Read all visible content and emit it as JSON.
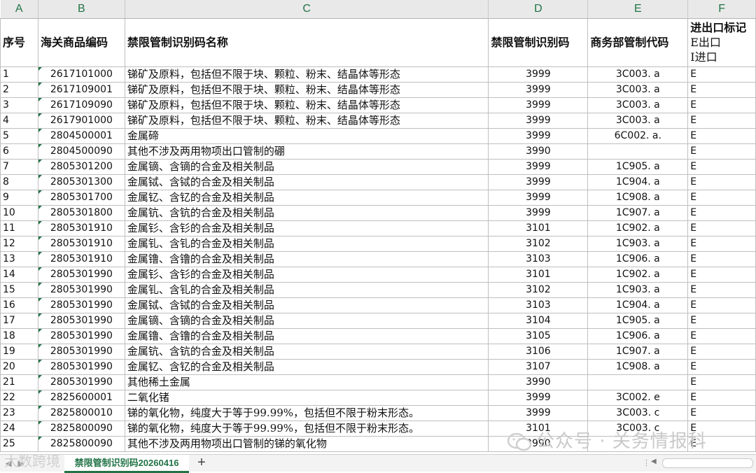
{
  "column_letters": [
    "A",
    "B",
    "C",
    "D",
    "E",
    "F"
  ],
  "header": {
    "seq": "序号",
    "hs_code": "海关商品编码",
    "name": "禁限管制识别码名称",
    "control_code": "禁限管制识别码",
    "mofcom_code": "商务部管制代码",
    "flag_title": "进出口标记",
    "flag_export": "E出口",
    "flag_import": "I进口"
  },
  "rows": [
    {
      "seq": "1",
      "hs": "2617101000",
      "name": "锑矿及原料，包括但不限于块、颗粒、粉末、结晶体等形态",
      "code": "3999",
      "mofcom": "3C003. a",
      "flag": "E"
    },
    {
      "seq": "2",
      "hs": "2617109001",
      "name": "锑矿及原料，包括但不限于块、颗粒、粉末、结晶体等形态",
      "code": "3999",
      "mofcom": "3C003. a",
      "flag": "E"
    },
    {
      "seq": "3",
      "hs": "2617109090",
      "name": "锑矿及原料，包括但不限于块、颗粒、粉末、结晶体等形态",
      "code": "3999",
      "mofcom": "3C003. a",
      "flag": "E"
    },
    {
      "seq": "4",
      "hs": "2617901000",
      "name": "锑矿及原料，包括但不限于块、颗粒、粉末、结晶体等形态",
      "code": "3999",
      "mofcom": "3C003. a",
      "flag": "E"
    },
    {
      "seq": "5",
      "hs": "2804500001",
      "name": "金属碲",
      "code": "3999",
      "mofcom": "6C002. a.",
      "flag": "E"
    },
    {
      "seq": "6",
      "hs": "2804500090",
      "name": "其他不涉及两用物项出口管制的硼",
      "code": "3990",
      "mofcom": "",
      "flag": "E"
    },
    {
      "seq": "7",
      "hs": "2805301200",
      "name": "金属镝、含镝的合金及相关制品",
      "code": "3999",
      "mofcom": "1C905. a",
      "flag": "E"
    },
    {
      "seq": "8",
      "hs": "2805301300",
      "name": "金属铽、含铽的合金及相关制品",
      "code": "3999",
      "mofcom": "1C904. a",
      "flag": "E"
    },
    {
      "seq": "9",
      "hs": "2805301700",
      "name": "金属钇、含钇的合金及相关制品",
      "code": "3999",
      "mofcom": "1C908. a",
      "flag": "E"
    },
    {
      "seq": "10",
      "hs": "2805301800",
      "name": "金属钪、含钪的合金及相关制品",
      "code": "3999",
      "mofcom": "1C907. a",
      "flag": "E"
    },
    {
      "seq": "11",
      "hs": "2805301910",
      "name": "金属钐、含钐的合金及相关制品",
      "code": "3101",
      "mofcom": "1C902. a",
      "flag": "E"
    },
    {
      "seq": "12",
      "hs": "2805301910",
      "name": "金属钆、含钆的合金及相关制品",
      "code": "3102",
      "mofcom": "1C903. a",
      "flag": "E"
    },
    {
      "seq": "13",
      "hs": "2805301910",
      "name": "金属镥、含镥的合金及相关制品",
      "code": "3103",
      "mofcom": "1C906. a",
      "flag": "E"
    },
    {
      "seq": "14",
      "hs": "2805301990",
      "name": "金属钐、含钐的合金及相关制品",
      "code": "3101",
      "mofcom": "1C902. a",
      "flag": "E"
    },
    {
      "seq": "15",
      "hs": "2805301990",
      "name": "金属钆、含钆的合金及相关制品",
      "code": "3102",
      "mofcom": "1C903. a",
      "flag": "E"
    },
    {
      "seq": "16",
      "hs": "2805301990",
      "name": "金属铽、含铽的合金及相关制品",
      "code": "3103",
      "mofcom": "1C904. a",
      "flag": "E"
    },
    {
      "seq": "17",
      "hs": "2805301990",
      "name": "金属镝、含镝的合金及相关制品",
      "code": "3104",
      "mofcom": "1C905. a",
      "flag": "E"
    },
    {
      "seq": "18",
      "hs": "2805301990",
      "name": "金属镥、含镥的合金及相关制品",
      "code": "3105",
      "mofcom": "1C906. a",
      "flag": "E"
    },
    {
      "seq": "19",
      "hs": "2805301990",
      "name": "金属钪、含钪的合金及相关制品",
      "code": "3106",
      "mofcom": "1C907. a",
      "flag": "E"
    },
    {
      "seq": "20",
      "hs": "2805301990",
      "name": "金属钇、含钇的合金及相关制品",
      "code": "3107",
      "mofcom": "1C908. a",
      "flag": "E"
    },
    {
      "seq": "21",
      "hs": "2805301990",
      "name": "其他稀土金属",
      "code": "3990",
      "mofcom": "",
      "flag": "E"
    },
    {
      "seq": "22",
      "hs": "2825600001",
      "name": "二氧化锗",
      "code": "3999",
      "mofcom": "3C002. e",
      "flag": "E"
    },
    {
      "seq": "23",
      "hs": "2825800010",
      "name": "锑的氧化物，纯度大于等于99.99%，包括但不限于粉末形态。",
      "code": "3999",
      "mofcom": "3C003. c",
      "flag": "E"
    },
    {
      "seq": "24",
      "hs": "2825800090",
      "name": "锑的氧化物，纯度大于等于99.99%，包括但不限于粉末形态。",
      "code": "3101",
      "mofcom": "3C003. c",
      "flag": "E"
    },
    {
      "seq": "25",
      "hs": "2825800090",
      "name": "其他不涉及两用物项出口管制的锑的氧化物",
      "code": "3990",
      "mofcom": "",
      "flag": "E"
    }
  ],
  "sheet_tab": "禁限管制识别码20260416",
  "add_sheet_symbol": "+",
  "watermark": "公众号 · 关务情报科",
  "watermark2": "大数跨境",
  "colors": {
    "accent": "#217346",
    "grid": "#bfbfbf"
  }
}
